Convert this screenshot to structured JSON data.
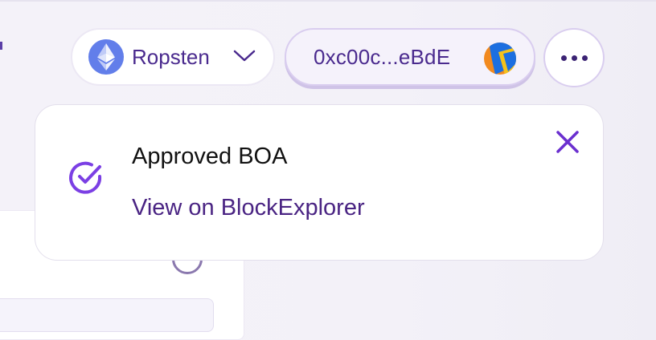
{
  "header": {
    "network": {
      "label": "Ropsten",
      "icon": "ethereum-icon",
      "dropdown_icon": "chevron-down-icon"
    },
    "account": {
      "address": "0xc00c...eBdE",
      "avatar_icon": "jazzicon-avatar"
    },
    "more_icon": "ellipsis-icon"
  },
  "toast": {
    "status_icon": "check-circle-icon",
    "title": "Approved BOA",
    "link_label": "View on BlockExplorer",
    "close_icon": "close-icon"
  },
  "colors": {
    "accent": "#7b3fe4",
    "text_primary": "#4a2a8e",
    "eth_blue": "#627eea"
  }
}
